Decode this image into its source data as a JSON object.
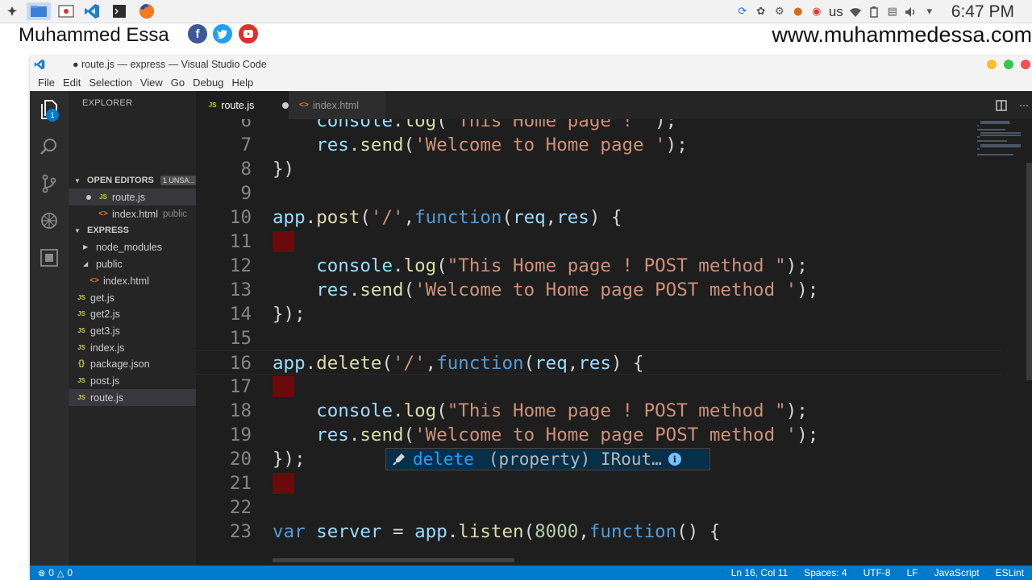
{
  "os_panel": {
    "keyboard_layout": "us",
    "clock": "6:47 PM"
  },
  "watermark": {
    "author": "Muhammed Essa",
    "website": "www.muhammedessa.com"
  },
  "window": {
    "title": "● route.js — express — Visual Studio Code"
  },
  "menu": [
    "File",
    "Edit",
    "Selection",
    "View",
    "Go",
    "Debug",
    "Help"
  ],
  "activity_bar": {
    "explorer_badge": "1"
  },
  "sidebar": {
    "title": "EXPLORER",
    "open_editors": {
      "label": "OPEN EDITORS",
      "badge": "1 UNSA...",
      "items": [
        {
          "name": "route.js",
          "hint": ""
        },
        {
          "name": "index.html",
          "hint": "public"
        }
      ]
    },
    "project": {
      "label": "EXPRESS",
      "items": [
        {
          "name": "node_modules"
        },
        {
          "name": "public"
        },
        {
          "name": "index.html"
        },
        {
          "name": "get.js"
        },
        {
          "name": "get2.js"
        },
        {
          "name": "get3.js"
        },
        {
          "name": "index.js"
        },
        {
          "name": "package.json"
        },
        {
          "name": "post.js"
        },
        {
          "name": "route.js"
        }
      ]
    }
  },
  "tabs": [
    {
      "label": "route.js",
      "icon": "JS",
      "dirty": true
    },
    {
      "label": "index.html",
      "icon": "<>",
      "dirty": false
    }
  ],
  "editor": {
    "lines": [
      {
        "n": "6",
        "text": "    console.log(\"This Home page ! \");"
      },
      {
        "n": "7",
        "text": "    res.send('Welcome to Home page ');"
      },
      {
        "n": "8",
        "text": "})"
      },
      {
        "n": "9",
        "text": ""
      },
      {
        "n": "10",
        "text": "app.post('/',function(req,res) {"
      },
      {
        "n": "11",
        "text": ""
      },
      {
        "n": "12",
        "text": "    console.log(\"This Home page ! POST method \");"
      },
      {
        "n": "13",
        "text": "    res.send('Welcome to Home page POST method ');"
      },
      {
        "n": "14",
        "text": "});"
      },
      {
        "n": "15",
        "text": ""
      },
      {
        "n": "16",
        "text": "app.delete('/',function(req,res) {"
      },
      {
        "n": "17",
        "text": ""
      },
      {
        "n": "18",
        "text": "    console.log(\"This Home page ! POST method \");"
      },
      {
        "n": "19",
        "text": "    res.send('Welcome to Home page POST method ');"
      },
      {
        "n": "20",
        "text": "});"
      },
      {
        "n": "21",
        "text": ""
      },
      {
        "n": "22",
        "text": ""
      },
      {
        "n": "23",
        "text": "var server = app.listen(8000,function() {"
      }
    ],
    "suggestion": {
      "label": "delete",
      "detail": "(property) IRout…",
      "info": "i"
    }
  },
  "statusbar": {
    "errors": "0",
    "warnings": "0",
    "position": "Ln 16, Col 11",
    "indent": "Spaces: 4",
    "encoding": "UTF-8",
    "eol": "LF",
    "language": "JavaScript",
    "linter": "ESLint"
  },
  "colors": {
    "accent": "#007acc",
    "editor_bg": "#1e1e1e",
    "sidebar_bg": "#252526",
    "string": "#ce9178",
    "keyword": "#569cd6",
    "function": "#dcdcaa"
  }
}
